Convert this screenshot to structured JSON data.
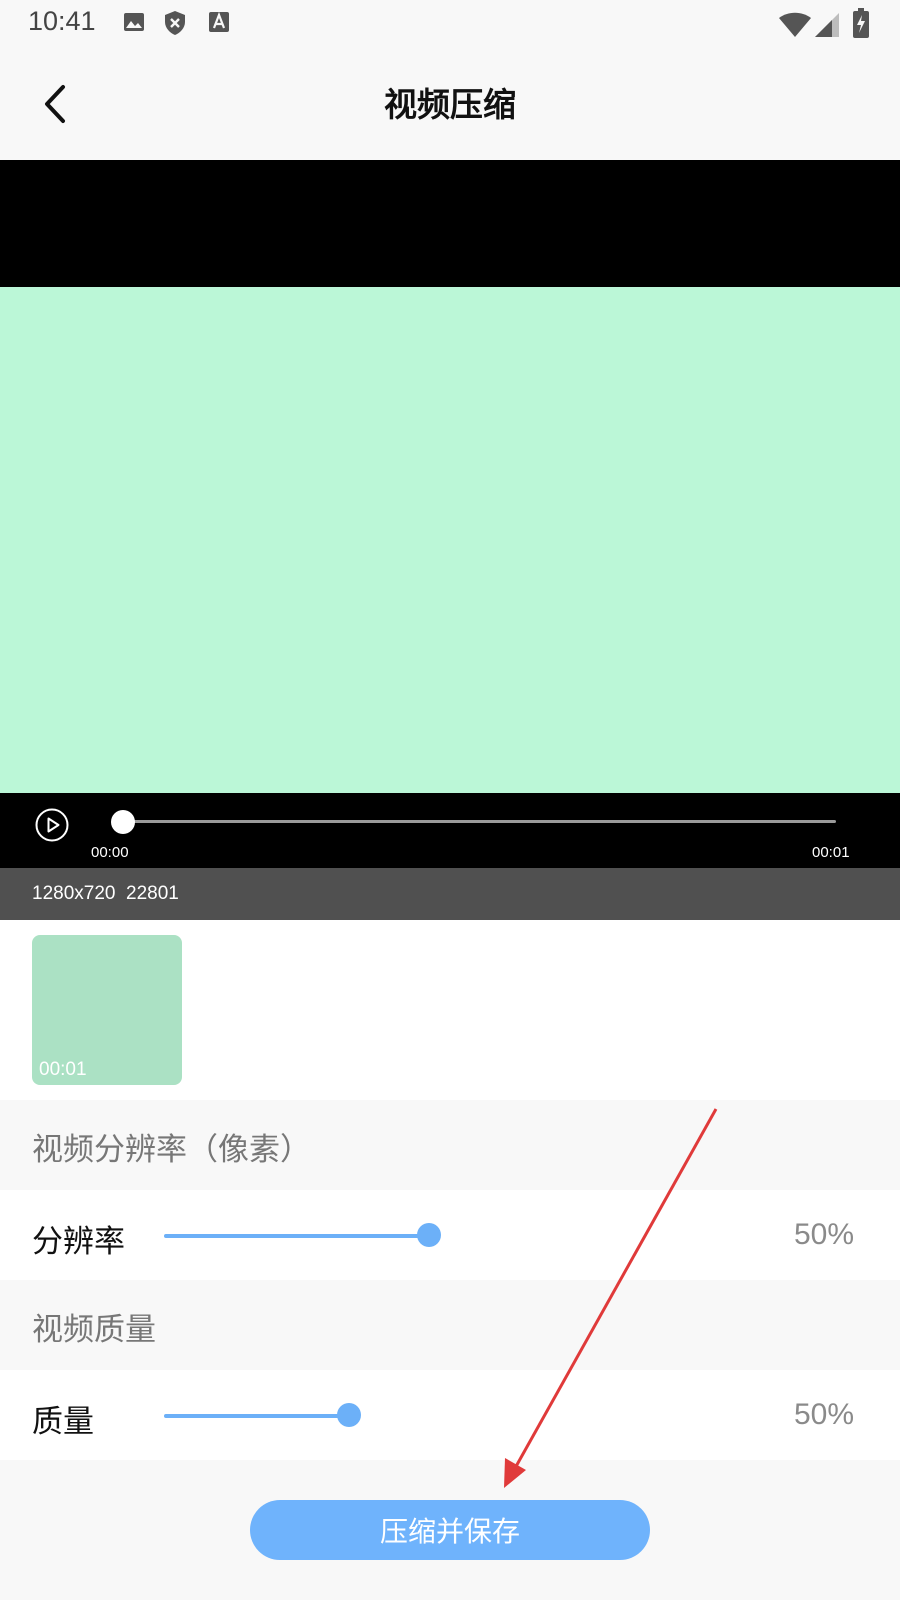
{
  "status_bar": {
    "time": "10:41",
    "icons_left": [
      "image-icon",
      "shield-x-icon",
      "text-a-icon"
    ],
    "icons_right": [
      "wifi-icon",
      "signal-icon",
      "battery-charging-icon"
    ]
  },
  "app_bar": {
    "title": "视频压缩",
    "back_icon": "chevron-left-icon"
  },
  "player": {
    "current_time": "00:00",
    "duration": "00:01",
    "progress": 0.0,
    "frame_color": "#bbf7d7"
  },
  "video_info": "1280x720  22801",
  "thumbnails": [
    {
      "time": "00:01",
      "color": "#abe1c4"
    }
  ],
  "resolution_section": {
    "header": "视频分辨率（像素）",
    "label": "分辨率",
    "value_text": "50%",
    "value": 0.5
  },
  "quality_section": {
    "header": "视频质量",
    "label": "质量",
    "value_text": "50%",
    "value": 0.5
  },
  "primary_action": {
    "label": "压缩并保存"
  },
  "colors": {
    "accent": "#6cb0f8",
    "button": "#6fb3fc",
    "annotation": "#e03a3a"
  }
}
